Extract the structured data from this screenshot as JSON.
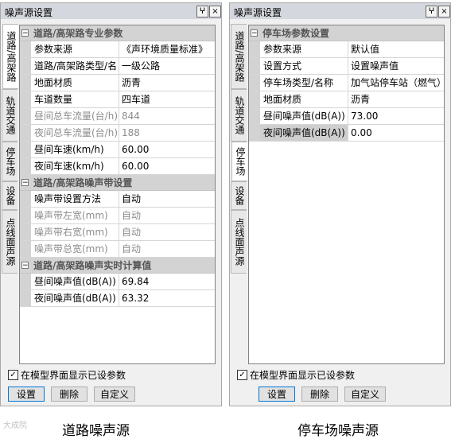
{
  "road": {
    "title": "噪声源设置",
    "pin": "ⵖ",
    "close": "×",
    "tabs": [
      "道路/高架路",
      "轨道交通",
      "停车场",
      "设备",
      "点线面声源"
    ],
    "cat1": "道路/高架路专业参数",
    "rows1": [
      {
        "k": "参数来源",
        "v": "《声环境质量标准》"
      },
      {
        "k": "道路/高架路类型/名",
        "v": "一级公路"
      },
      {
        "k": "地面材质",
        "v": "沥青"
      },
      {
        "k": "车道数量",
        "v": "四车道"
      },
      {
        "k": "昼间总车流量(台/h)",
        "v": "844"
      },
      {
        "k": "夜间总车流量(台/h)",
        "v": "188"
      },
      {
        "k": "昼间车速(km/h)",
        "v": "60.00"
      },
      {
        "k": "夜间车速(km/h)",
        "v": "60.00"
      }
    ],
    "cat2": "道路/高架路噪声带设置",
    "rows2": [
      {
        "k": "噪声带设置方法",
        "v": "自动"
      },
      {
        "k": "噪声带左宽(mm)",
        "v": "自动"
      },
      {
        "k": "噪声带右宽(mm)",
        "v": "自动"
      },
      {
        "k": "噪声带总宽(mm)",
        "v": "自动"
      }
    ],
    "cat3": "道路/高架路噪声实时计算值",
    "rows3": [
      {
        "k": "昼间噪声值(dB(A))",
        "v": "69.84"
      },
      {
        "k": "夜间噪声值(dB(A))",
        "v": "63.32"
      }
    ],
    "checkbox_label": "在模型界面显示已设参数",
    "buttons": {
      "set": "设置",
      "del": "删除",
      "custom": "自定义"
    },
    "caption": "道路噪声源"
  },
  "parking": {
    "title": "噪声源设置",
    "pin": "ⵖ",
    "close": "×",
    "tabs": [
      "道路/高架路",
      "轨道交通",
      "停车场",
      "设备",
      "点线面声源"
    ],
    "cat1": "停车场参数设置",
    "rows1": [
      {
        "k": "参数来源",
        "v": "默认值"
      },
      {
        "k": "设置方式",
        "v": "设置噪声值"
      },
      {
        "k": "停车场类型/名称",
        "v": "加气站停车站（燃气）"
      },
      {
        "k": "地面材质",
        "v": "沥青"
      },
      {
        "k": "昼间噪声值(dB(A))",
        "v": "73.00"
      },
      {
        "k": "夜间噪声值(dB(A))",
        "v": "0.00"
      }
    ],
    "checkbox_label": "在模型界面显示已设参数",
    "buttons": {
      "set": "设置",
      "del": "删除",
      "custom": "自定义"
    },
    "caption": "停车场噪声源"
  },
  "watermark": "大成院"
}
